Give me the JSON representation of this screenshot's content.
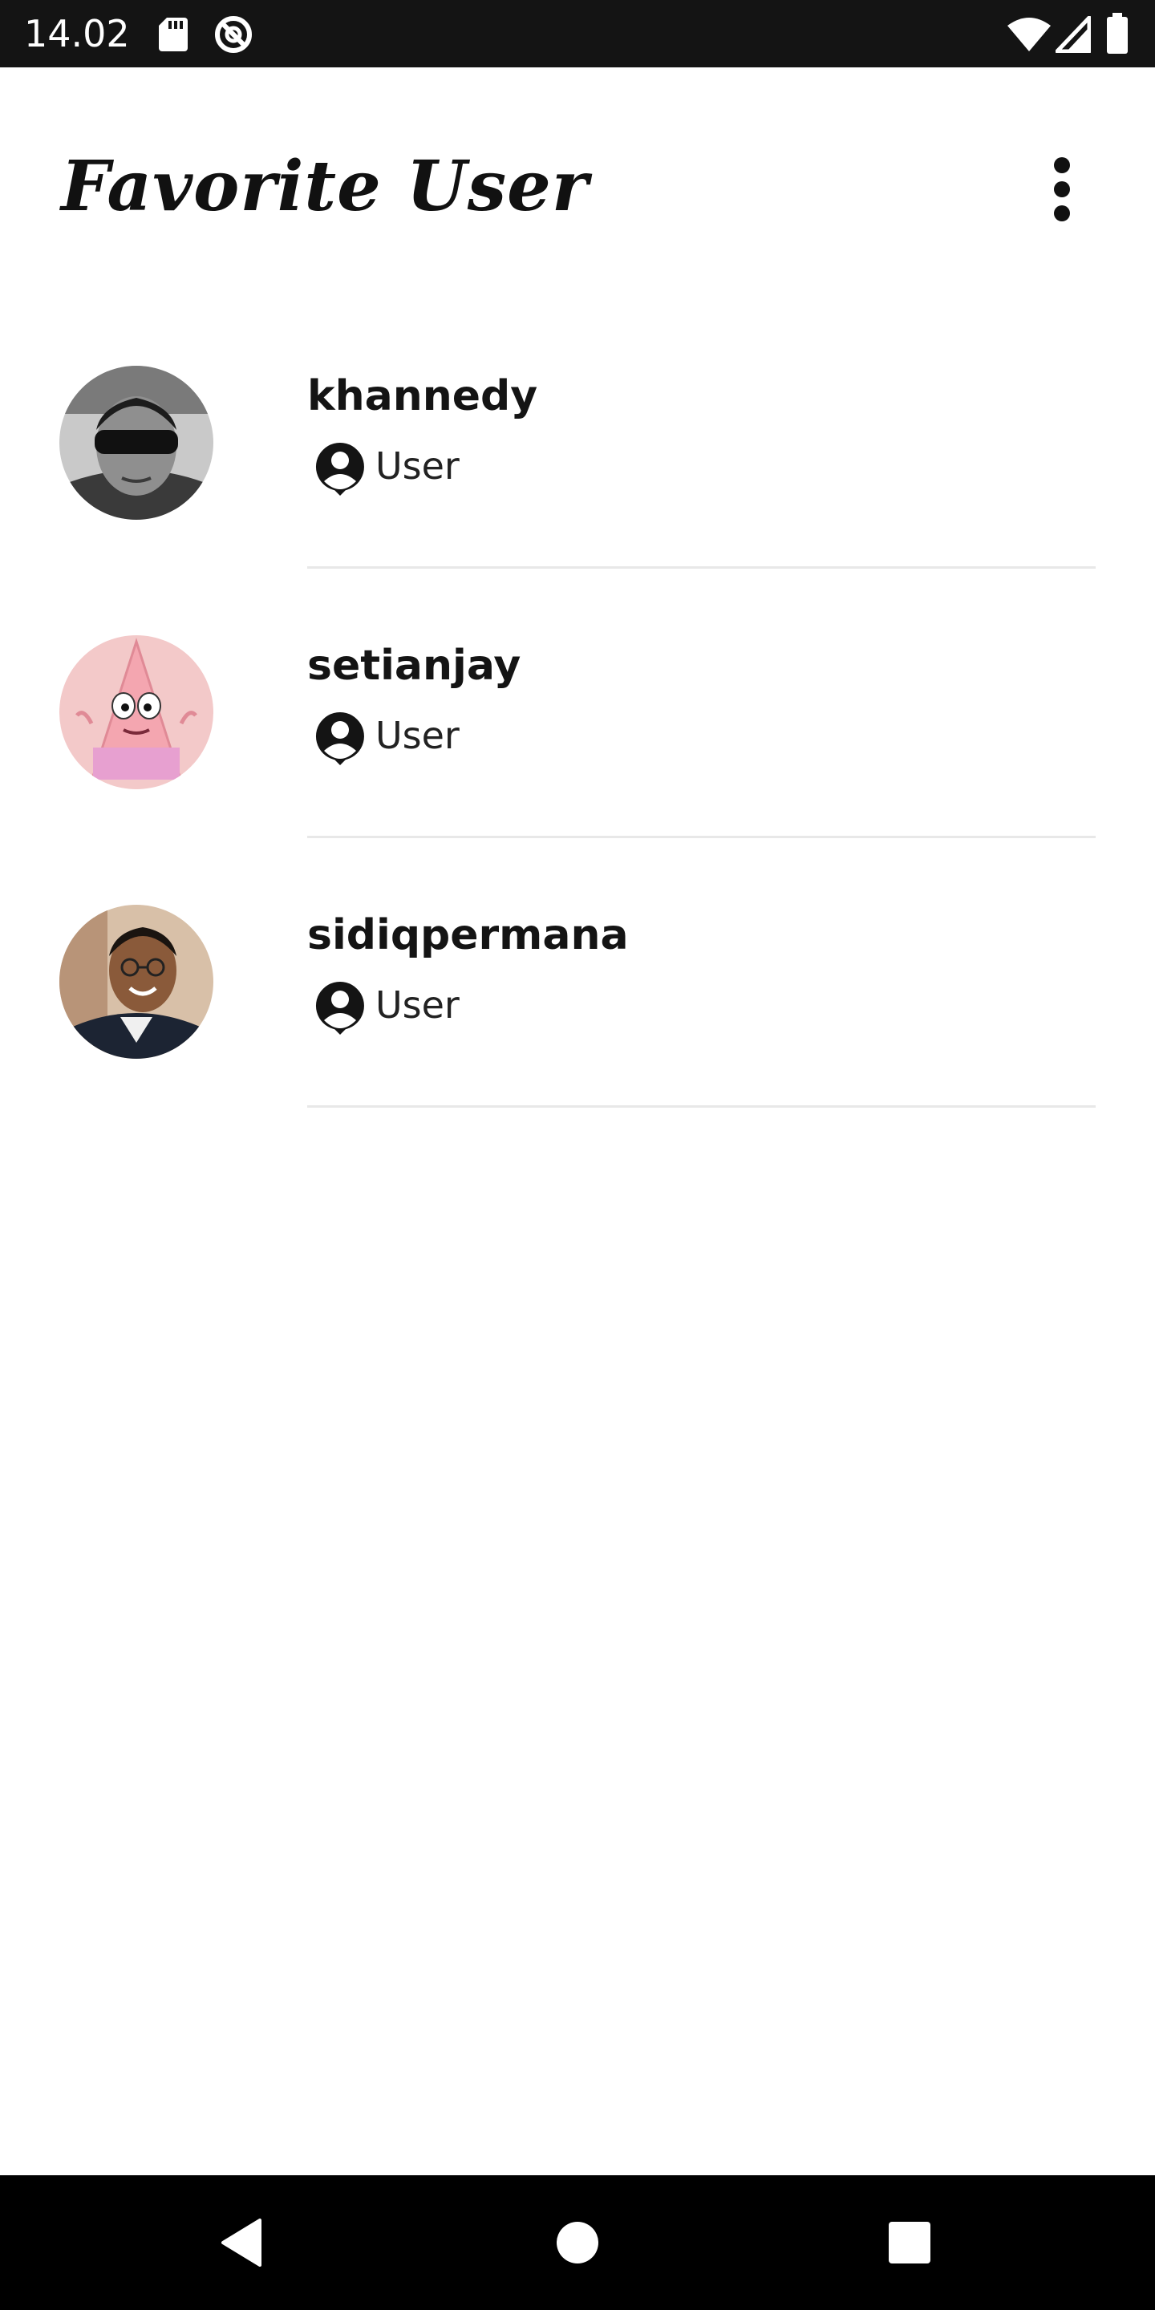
{
  "status_bar": {
    "time": "14.02",
    "icons": [
      "sd-card-icon",
      "no-disturb-icon",
      "wifi-icon",
      "signal-icon",
      "battery-icon"
    ]
  },
  "app_bar": {
    "title": "Favorite User",
    "menu_icon": "more-vert-icon"
  },
  "users": [
    {
      "username": "khannedy",
      "type_label": "User",
      "type_icon": "account-circle-icon",
      "avatar": "photo-person-sunglasses"
    },
    {
      "username": "setianjay",
      "type_label": "User",
      "type_icon": "account-circle-icon",
      "avatar": "cartoon-starfish"
    },
    {
      "username": "sidiqpermana",
      "type_label": "User",
      "type_icon": "account-circle-icon",
      "avatar": "photo-person-glasses"
    }
  ],
  "nav_bar": {
    "buttons": [
      "back-icon",
      "home-icon",
      "recents-icon"
    ]
  },
  "colors": {
    "status_bar_bg": "#141414",
    "nav_bar_bg": "#000000",
    "text_primary": "#141414",
    "divider": "#e8e8e8",
    "background": "#ffffff"
  }
}
